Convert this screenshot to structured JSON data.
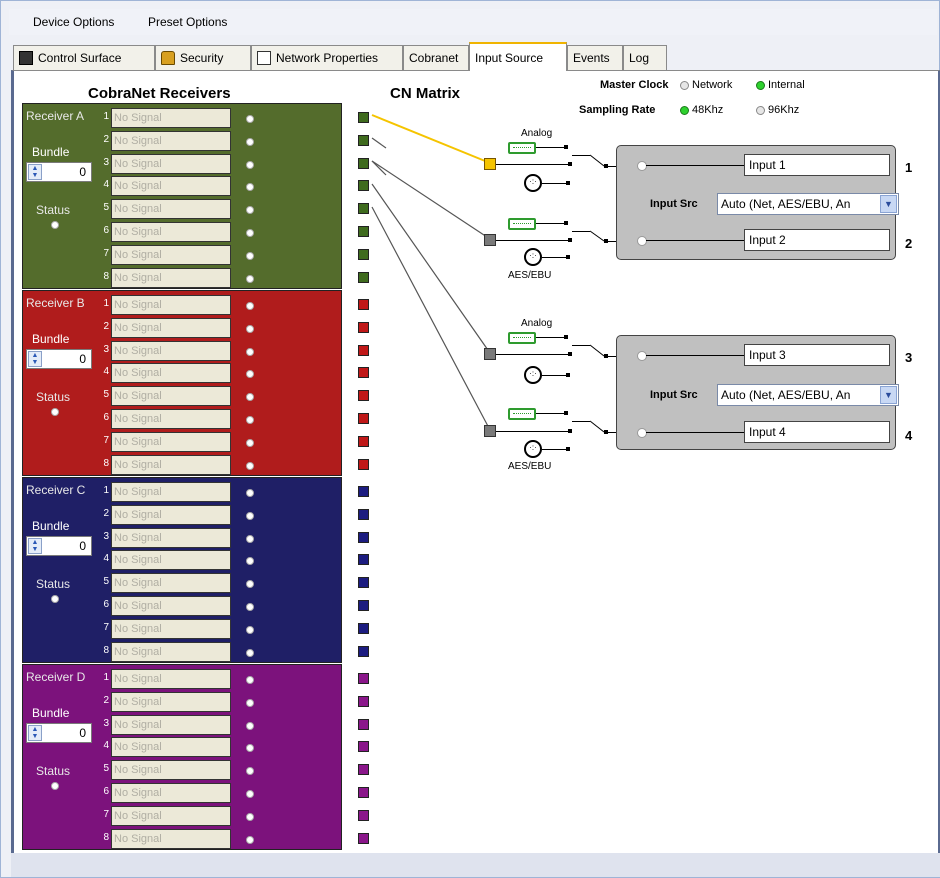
{
  "menu": [
    "Device Options",
    "Preset Options"
  ],
  "tabs": [
    {
      "label": "Control Surface",
      "icon": "control-surface-icon"
    },
    {
      "label": "Security",
      "icon": "lock-icon"
    },
    {
      "label": "Network Properties",
      "icon": "list-icon"
    },
    {
      "label": "Cobranet"
    },
    {
      "label": "Input Source",
      "active": true
    },
    {
      "label": "Events"
    },
    {
      "label": "Log"
    }
  ],
  "headers": {
    "receivers_title": "CobraNet Receivers",
    "matrix_title": "CN Matrix"
  },
  "clock": {
    "master_label": "Master Clock",
    "network": "Network",
    "internal": "Internal",
    "sampling_label": "Sampling Rate",
    "rate_48": "48Khz",
    "rate_96": "96Khz",
    "master_selected": "Internal",
    "rate_selected": "48Khz"
  },
  "receivers": [
    {
      "name": "Receiver A",
      "color": "#546c2c",
      "sq_color": "#3f6b1e",
      "bundle_label": "Bundle",
      "bundle": "0",
      "status_label": "Status"
    },
    {
      "name": "Receiver B",
      "color": "#b01c1c",
      "sq_color": "#c01818",
      "bundle_label": "Bundle",
      "bundle": "0",
      "status_label": "Status"
    },
    {
      "name": "Receiver C",
      "color": "#1f1f66",
      "sq_color": "#1c1c80",
      "bundle_label": "Bundle",
      "bundle": "0",
      "status_label": "Status"
    },
    {
      "name": "Receiver D",
      "color": "#7c127c",
      "sq_color": "#8a168a",
      "bundle_label": "Bundle",
      "bundle": "0",
      "status_label": "Status"
    }
  ],
  "channels": [
    "1",
    "2",
    "3",
    "4",
    "5",
    "6",
    "7",
    "8"
  ],
  "no_signal": "No Signal",
  "labels": {
    "analog": "Analog",
    "aes": "AES/EBU",
    "input_src": "Input Src"
  },
  "inputs": [
    {
      "label": "Input 1",
      "num": "1"
    },
    {
      "label": "Input 2",
      "num": "2"
    },
    {
      "label": "Input 3",
      "num": "3"
    },
    {
      "label": "Input 4",
      "num": "4"
    }
  ],
  "input_src_values": [
    "Auto (Net, AES/EBU, An",
    "Auto (Net, AES/EBU, An"
  ],
  "accent": "#f5c400"
}
